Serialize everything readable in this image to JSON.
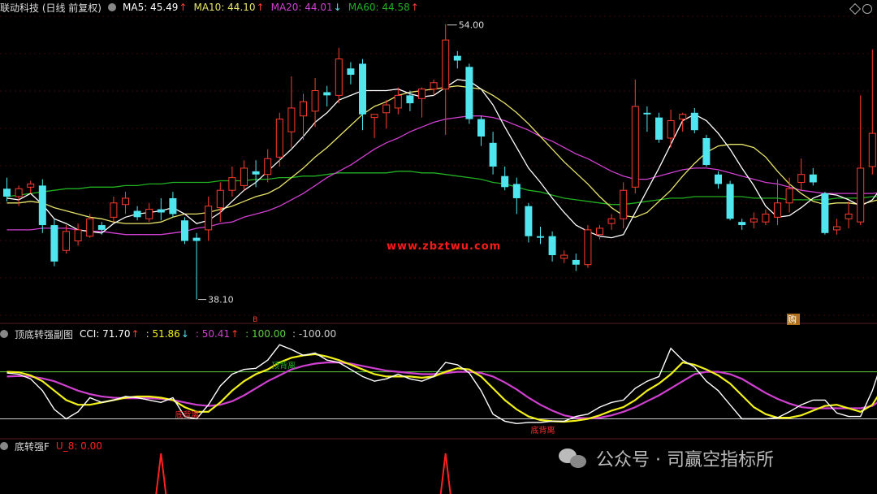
{
  "colors": {
    "bg": "#000000",
    "up": "#ff3b30",
    "down": "#50e6f0",
    "ma5": "#ffffff",
    "ma10": "#e8e36a",
    "ma20": "#d040d0",
    "ma60": "#22b022",
    "cci_white": "#ffffff",
    "cci_yellow": "#f2f21a",
    "cci_magenta": "#d040d0",
    "level_green": "#5fcf40",
    "level_white": "#cccccc",
    "signal": "#ff2020"
  },
  "header": {
    "title": "联动科技 (日线 前复权)",
    "ma5": "MA5: 45.49",
    "ma5_arrow": "↑",
    "ma10": "MA10: 44.10",
    "ma10_arrow": "↑",
    "ma20": "MA20: 44.01",
    "ma20_arrow": "↓",
    "ma60": "MA60: 44.58",
    "ma60_arrow": "↑"
  },
  "panel2": {
    "title": "顶底转强副图",
    "cci": "CCI: 71.70",
    "cci_arrow": "↑",
    "v1": ": 51.86",
    "v1_arrow": "↓",
    "v2": ": 50.41",
    "v2_arrow": "↑",
    "v3": ": 100.00",
    "v4": ": -100.00"
  },
  "panel3": {
    "title": "底转强F",
    "value": "U_8: 0.00"
  },
  "watermark": {
    "text": "公众号 · 司赢空指标所",
    "url": "www.zbztwu.com"
  },
  "annotations": {
    "high": "54.00",
    "low": "38.10",
    "buy": "购",
    "sell_marker": "B",
    "top_div": "顶背离",
    "bottom_div1": "底背离",
    "bottom_div2": "底背离"
  },
  "chart_data": [
    {
      "type": "candlestick",
      "title": "联动科技 (日线 前复权)",
      "ylim": [
        37,
        56
      ],
      "candles": [
        [
          45.1,
          45.8,
          44.3,
          44.6
        ],
        [
          44.6,
          45.3,
          44.0,
          45.1
        ],
        [
          45.2,
          45.6,
          44.8,
          45.4
        ],
        [
          45.3,
          45.7,
          42.3,
          42.8
        ],
        [
          42.8,
          43.2,
          40.2,
          40.5
        ],
        [
          41.2,
          42.8,
          41.0,
          42.4
        ],
        [
          41.8,
          42.9,
          41.5,
          42.5
        ],
        [
          42.1,
          43.5,
          42.0,
          43.2
        ],
        [
          42.8,
          43.0,
          42.2,
          42.5
        ],
        [
          43.3,
          44.6,
          43.0,
          44.2
        ],
        [
          44.1,
          44.9,
          43.5,
          44.5
        ],
        [
          43.7,
          44.0,
          43.1,
          43.3
        ],
        [
          43.2,
          44.2,
          43.0,
          43.8
        ],
        [
          43.8,
          44.5,
          43.1,
          43.6
        ],
        [
          44.5,
          44.9,
          43.3,
          43.5
        ],
        [
          43.1,
          43.3,
          41.6,
          41.8
        ],
        [
          42.0,
          42.3,
          38.1,
          41.8
        ],
        [
          42.5,
          44.6,
          41.8,
          44.0
        ],
        [
          43.9,
          45.5,
          43.0,
          45.0
        ],
        [
          45.0,
          46.5,
          44.6,
          45.8
        ],
        [
          45.3,
          46.9,
          45.0,
          46.4
        ],
        [
          46.2,
          46.9,
          45.2,
          46.0
        ],
        [
          46.0,
          47.6,
          45.5,
          47.0
        ],
        [
          47.1,
          49.9,
          46.5,
          49.5
        ],
        [
          48.7,
          52.2,
          47.7,
          50.2
        ],
        [
          49.7,
          51.1,
          48.2,
          50.6
        ],
        [
          50.0,
          52.1,
          49.0,
          51.3
        ],
        [
          51.2,
          51.6,
          50.3,
          51.0
        ],
        [
          51.0,
          54.0,
          50.5,
          53.3
        ],
        [
          52.7,
          53.1,
          51.7,
          52.3
        ],
        [
          53.0,
          53.3,
          48.8,
          49.8
        ],
        [
          49.6,
          49.8,
          48.3,
          49.8
        ],
        [
          49.9,
          50.7,
          48.9,
          50.4
        ],
        [
          50.2,
          51.5,
          49.8,
          51.0
        ],
        [
          51.0,
          51.3,
          50.0,
          50.5
        ],
        [
          50.8,
          51.5,
          49.6,
          51.4
        ],
        [
          51.4,
          52.0,
          51.0,
          51.8
        ],
        [
          51.4,
          55.5,
          48.5,
          54.5
        ],
        [
          53.5,
          53.8,
          52.7,
          53.2
        ],
        [
          52.8,
          53.0,
          49.2,
          49.5
        ],
        [
          49.5,
          49.7,
          47.8,
          48.4
        ],
        [
          48.0,
          48.7,
          46.0,
          46.5
        ],
        [
          45.9,
          46.5,
          45.0,
          45.2
        ],
        [
          45.4,
          45.8,
          43.5,
          44.5
        ],
        [
          44.0,
          44.2,
          41.7,
          42.1
        ],
        [
          42.1,
          42.7,
          41.6,
          42.0
        ],
        [
          42.1,
          42.4,
          40.5,
          40.9
        ],
        [
          40.7,
          41.2,
          40.4,
          40.9
        ],
        [
          40.6,
          41.0,
          39.9,
          40.3
        ],
        [
          40.3,
          42.8,
          40.1,
          42.5
        ],
        [
          42.2,
          42.8,
          41.9,
          42.6
        ],
        [
          42.9,
          43.5,
          42.5,
          43.2
        ],
        [
          43.2,
          45.5,
          42.6,
          45.0
        ],
        [
          45.2,
          52.0,
          44.8,
          50.3
        ],
        [
          49.9,
          50.3,
          48.7,
          49.8
        ],
        [
          49.6,
          49.9,
          48.0,
          48.2
        ],
        [
          48.3,
          50.1,
          47.7,
          49.4
        ],
        [
          49.5,
          49.9,
          48.7,
          49.8
        ],
        [
          49.9,
          50.2,
          48.6,
          48.8
        ],
        [
          48.3,
          48.5,
          46.5,
          46.6
        ],
        [
          46.0,
          46.2,
          45.1,
          45.4
        ],
        [
          45.4,
          45.6,
          43.1,
          43.2
        ],
        [
          43.0,
          43.2,
          42.5,
          42.8
        ],
        [
          43.0,
          43.6,
          42.6,
          43.2
        ],
        [
          43.0,
          43.8,
          42.8,
          43.5
        ],
        [
          43.3,
          45.7,
          42.8,
          44.2
        ],
        [
          44.2,
          45.8,
          43.6,
          45.1
        ],
        [
          45.5,
          47.0,
          45.0,
          46.0
        ],
        [
          46.0,
          46.4,
          45.3,
          45.5
        ],
        [
          44.8,
          44.9,
          42.2,
          42.3
        ],
        [
          42.5,
          43.2,
          42.2,
          42.7
        ],
        [
          43.2,
          44.3,
          42.6,
          43.5
        ],
        [
          43.0,
          51.0,
          42.8,
          46.4
        ],
        [
          46.5,
          53.9,
          46.0,
          48.6
        ],
        [
          48.3,
          48.8,
          47.0,
          47.5
        ],
        [
          47.8,
          48.5,
          46.7,
          45.2
        ]
      ],
      "ma5": [
        44.5,
        44.4,
        44.8,
        44.1,
        43.2,
        42.9,
        42.5,
        42.4,
        42.3,
        42.9,
        43.3,
        43.5,
        43.6,
        43.7,
        43.9,
        43.5,
        42.9,
        43.1,
        43.6,
        44.3,
        45.0,
        45.5,
        46.2,
        46.9,
        47.6,
        48.4,
        49.3,
        49.9,
        50.7,
        51.0,
        51.3,
        51.3,
        51.3,
        51.4,
        51.1,
        50.9,
        51.0,
        51.5,
        52.0,
        51.9,
        51.4,
        50.4,
        49.0,
        47.7,
        46.4,
        45.5,
        44.5,
        43.6,
        42.8,
        42.4,
        42.1,
        42.0,
        42.2,
        43.6,
        45.0,
        46.4,
        47.9,
        49.4,
        49.8,
        49.4,
        48.6,
        47.6,
        46.4,
        45.3,
        44.0,
        43.3,
        43.4,
        43.9,
        44.5,
        44.8,
        44.7,
        44.4,
        44.0,
        44.4,
        45.4,
        46.2
      ],
      "ma10": [
        44.2,
        44.2,
        44.3,
        44.2,
        43.9,
        43.7,
        43.5,
        43.3,
        43.2,
        43.0,
        42.9,
        42.9,
        42.9,
        43.0,
        43.3,
        43.5,
        43.5,
        43.6,
        43.8,
        44.0,
        44.3,
        44.6,
        44.8,
        45.2,
        45.8,
        46.4,
        47.1,
        47.7,
        48.4,
        49.1,
        49.8,
        50.3,
        50.6,
        51.0,
        51.2,
        51.3,
        51.4,
        51.5,
        51.6,
        51.5,
        51.4,
        51.0,
        50.5,
        49.9,
        49.2,
        48.4,
        47.6,
        46.8,
        46.1,
        45.4,
        44.6,
        43.9,
        43.4,
        43.3,
        43.6,
        44.3,
        45.0,
        45.9,
        46.7,
        47.4,
        47.8,
        47.9,
        47.9,
        47.7,
        47.1,
        46.2,
        45.4,
        44.8,
        44.3,
        44.1,
        44.2,
        44.2,
        44.1,
        44.3,
        44.5,
        44.7
      ],
      "ma20": [
        42.5,
        42.5,
        42.5,
        42.6,
        42.6,
        42.6,
        42.5,
        42.4,
        42.4,
        42.3,
        42.2,
        42.2,
        42.2,
        42.2,
        42.3,
        42.4,
        42.6,
        42.7,
        42.9,
        43.0,
        43.3,
        43.5,
        43.7,
        44.0,
        44.4,
        44.8,
        45.3,
        45.8,
        46.2,
        46.6,
        47.1,
        47.6,
        48.0,
        48.3,
        48.7,
        49.0,
        49.3,
        49.5,
        49.6,
        49.7,
        49.7,
        49.6,
        49.4,
        49.1,
        48.8,
        48.4,
        48.1,
        47.7,
        47.3,
        47.0,
        46.6,
        46.2,
        45.9,
        45.7,
        45.7,
        45.9,
        46.1,
        46.3,
        46.4,
        46.4,
        46.3,
        46.1,
        45.9,
        45.7,
        45.5,
        45.4,
        45.2,
        45.0,
        44.9,
        44.8,
        44.8,
        44.8,
        44.8,
        44.8,
        44.9,
        45.0
      ],
      "ma60": [
        44.6,
        44.7,
        44.8,
        44.9,
        45.0,
        45.1,
        45.1,
        45.2,
        45.2,
        45.2,
        45.3,
        45.3,
        45.4,
        45.4,
        45.5,
        45.5,
        45.5,
        45.5,
        45.6,
        45.6,
        45.6,
        45.7,
        45.7,
        45.8,
        45.8,
        45.9,
        45.9,
        46.0,
        46.1,
        46.1,
        46.1,
        46.1,
        46.1,
        46.2,
        46.2,
        46.1,
        46.1,
        46.0,
        45.9,
        45.8,
        45.7,
        45.5,
        45.4,
        45.2,
        45.0,
        44.9,
        44.7,
        44.5,
        44.4,
        44.3,
        44.2,
        44.1,
        44.1,
        44.2,
        44.3,
        44.4,
        44.5,
        44.5,
        44.6,
        44.6,
        44.6,
        44.6,
        44.6,
        44.5,
        44.5,
        44.5,
        44.4,
        44.4,
        44.4,
        44.4,
        44.5,
        44.5,
        44.5,
        44.6,
        44.6,
        44.6
      ]
    },
    {
      "type": "line",
      "title": "顶底转强副图",
      "ylim": [
        -150,
        230
      ],
      "levels": [
        100,
        -100
      ],
      "series": [
        {
          "name": "CCI",
          "values": [
            95,
            90,
            70,
            20,
            -60,
            -100,
            -70,
            -10,
            -30,
            -20,
            -5,
            -10,
            -20,
            -30,
            -10,
            -90,
            -100,
            -40,
            40,
            90,
            110,
            115,
            150,
            215,
            195,
            170,
            180,
            150,
            140,
            110,
            80,
            60,
            70,
            90,
            70,
            60,
            80,
            140,
            130,
            95,
            20,
            -80,
            -110,
            -120,
            -115,
            -115,
            -110,
            -110,
            -90,
            -80,
            -50,
            -30,
            -20,
            30,
            60,
            80,
            200,
            150,
            120,
            60,
            20,
            -40,
            -100,
            -100,
            -100,
            -95,
            -70,
            -40,
            -20,
            -20,
            -75,
            -90,
            -90,
            20,
            170,
            80,
            70
          ]
        },
        {
          "name": "",
          "values": [
            100,
            98,
            85,
            60,
            20,
            -20,
            -40,
            -40,
            -30,
            -20,
            -10,
            -5,
            -5,
            -10,
            -20,
            -50,
            -70,
            -70,
            -30,
            20,
            60,
            90,
            110,
            140,
            160,
            170,
            175,
            165,
            150,
            130,
            110,
            90,
            80,
            80,
            80,
            75,
            80,
            100,
            115,
            110,
            80,
            30,
            -20,
            -60,
            -90,
            -105,
            -110,
            -112,
            -108,
            -100,
            -85,
            -65,
            -50,
            -20,
            20,
            50,
            90,
            140,
            130,
            110,
            85,
            50,
            0,
            -50,
            -80,
            -95,
            -95,
            -85,
            -65,
            -45,
            -40,
            -55,
            -70,
            -40,
            40,
            70,
            75
          ]
        },
        {
          "name": "",
          "values": [
            80,
            82,
            80,
            72,
            60,
            40,
            20,
            5,
            -5,
            -10,
            -12,
            -12,
            -12,
            -15,
            -20,
            -30,
            -40,
            -45,
            -40,
            -25,
            0,
            30,
            60,
            85,
            110,
            125,
            135,
            140,
            140,
            135,
            125,
            115,
            105,
            100,
            95,
            90,
            90,
            95,
            100,
            100,
            95,
            80,
            55,
            25,
            -10,
            -40,
            -65,
            -85,
            -95,
            -98,
            -95,
            -85,
            -70,
            -50,
            -25,
            0,
            30,
            60,
            90,
            100,
            100,
            90,
            70,
            40,
            10,
            -15,
            -35,
            -50,
            -55,
            -55,
            -55,
            -55,
            -55,
            -45,
            -10,
            20,
            40
          ]
        }
      ]
    },
    {
      "type": "line",
      "title": "底转强F",
      "series": [
        {
          "name": "U_8",
          "spikes_at": [
            13,
            37
          ]
        }
      ]
    }
  ]
}
